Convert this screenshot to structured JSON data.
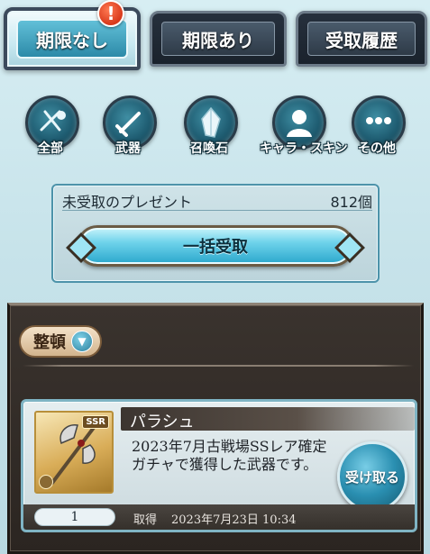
{
  "tabs": [
    {
      "label": "期限なし",
      "active": true
    },
    {
      "label": "期限あり",
      "active": false
    },
    {
      "label": "受取履歴",
      "active": false
    }
  ],
  "alert_badge": "!",
  "categories": [
    {
      "label": "全部",
      "icon": "all-items-icon"
    },
    {
      "label": "武器",
      "icon": "weapon-icon"
    },
    {
      "label": "召喚石",
      "icon": "summon-crystal-icon"
    },
    {
      "label": "キャラ・スキン",
      "icon": "character-silhouette-icon"
    },
    {
      "label": "その他",
      "icon": "more-dots-icon"
    }
  ],
  "summary": {
    "label": "未受取のプレゼント",
    "count": "812個",
    "bulk_button": "一括受取"
  },
  "sort": {
    "label": "整頓",
    "icon": "chevron-down-icon"
  },
  "present": {
    "name": "パラシュ",
    "description": "2023年7月古戦場SSレア確定ガチャで獲得した武器です。",
    "rarity": "SSR",
    "quantity": "1",
    "acquired_label": "取得",
    "acquired_date": "2023年7月23日 10:34",
    "receive_button": "受け取る",
    "icon": "axe-weapon-icon"
  },
  "colors": {
    "active_tab": "#3fa6c4",
    "button_blue": "#2aa7cc",
    "panel_dark": "#2b2521",
    "alert": "#d8391b"
  }
}
